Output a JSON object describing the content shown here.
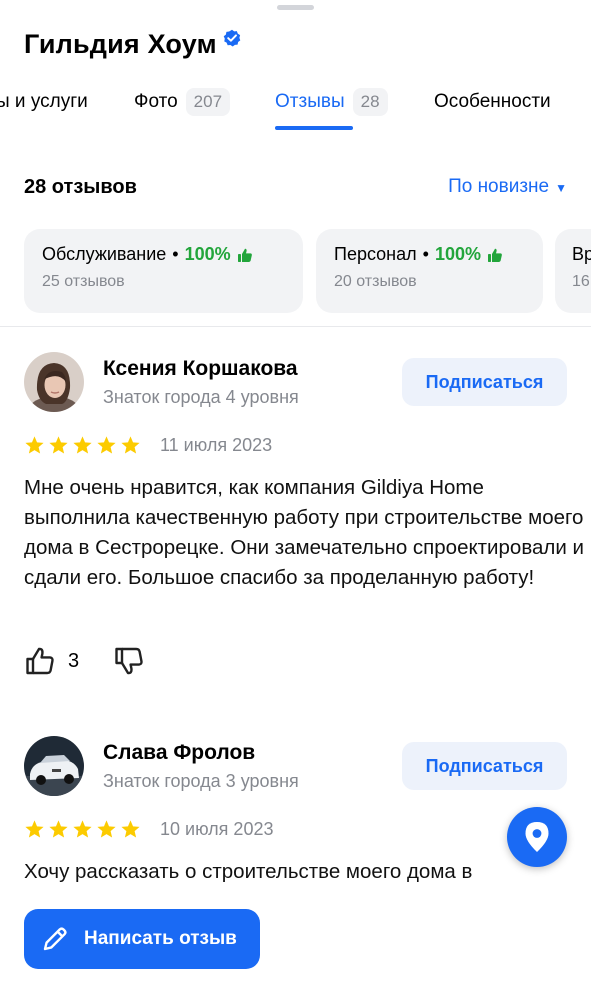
{
  "org": {
    "name": "Гильдия Хоум"
  },
  "tabs": [
    {
      "label": "ы и услуги",
      "count": ""
    },
    {
      "label": "Фото",
      "count": "207"
    },
    {
      "label": "Отзывы",
      "count": "28"
    },
    {
      "label": "Особенности",
      "count": ""
    }
  ],
  "reviews_header": {
    "count_label": "28 отзывов",
    "sort_label": "По новизне"
  },
  "aspects": [
    {
      "title": "Обслуживание",
      "percent": "100%",
      "sub": "25 отзывов"
    },
    {
      "title": "Персонал",
      "percent": "100%",
      "sub": "20 отзывов"
    },
    {
      "title": "Вр",
      "percent": "",
      "sub": "16"
    }
  ],
  "reviews": [
    {
      "author": "Ксения Коршакова",
      "level": "Знаток города 4 уровня",
      "subscribe": "Подписаться",
      "rating": 5,
      "date": "11 июля 2023",
      "text": "Мне очень нравится, как компания Gildiya Home выполнила качественную работу при строительстве моего дома в Сестрорецке. Они замечательно спроектировали и сдали его. Большое спасибо за проделанную работу!",
      "likes": "3"
    },
    {
      "author": "Слава Фролов",
      "level": "Знаток города 3 уровня",
      "subscribe": "Подписаться",
      "rating": 5,
      "date": "10 июля 2023",
      "text": "Хочу рассказать о строительстве моего дома в"
    }
  ],
  "write_review": {
    "label": "Написать отзыв"
  },
  "colors": {
    "accent": "#1a6af4",
    "positive": "#22a53b",
    "star": "#fccb00",
    "muted": "#85888f"
  }
}
